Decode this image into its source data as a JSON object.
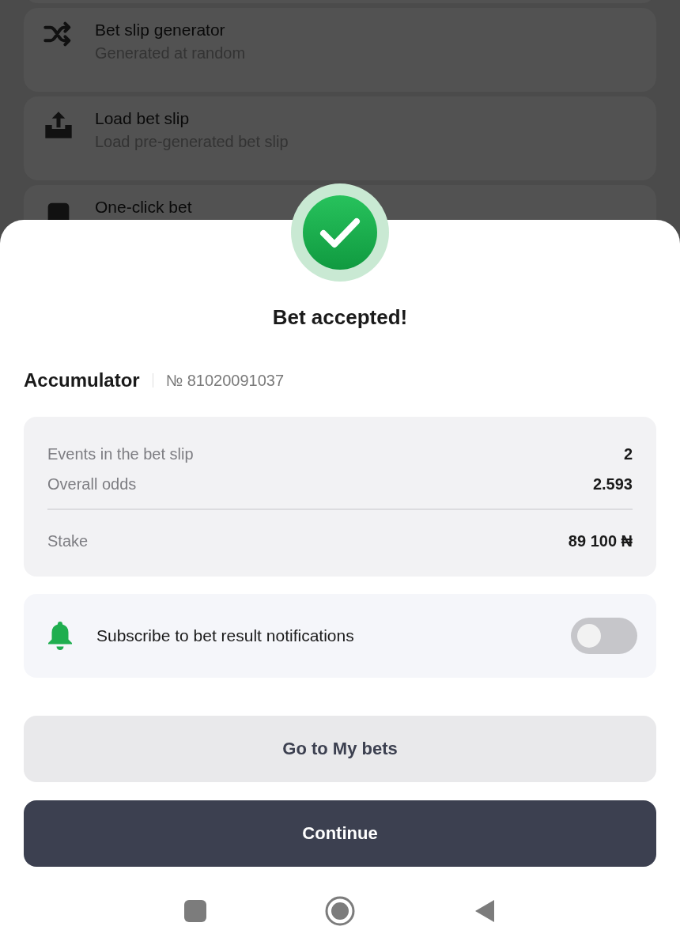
{
  "background_menu": [
    {
      "kind": "shuffle",
      "title": "Bet slip generator",
      "subtitle": "Generated at random"
    },
    {
      "kind": "upload",
      "title": "Load bet slip",
      "subtitle": "Load pre-generated bet slip"
    },
    {
      "kind": "partial",
      "title": "One-click bet"
    }
  ],
  "sheet": {
    "title": "Bet accepted!",
    "bet_type": "Accumulator",
    "bet_number": "№ 81020091037",
    "summary": [
      {
        "label": "Events in the bet slip",
        "value": "2"
      },
      {
        "label": "Overall odds",
        "value": "2.593"
      },
      {
        "label": "Stake",
        "value": "89 100 ₦",
        "divider_before": true
      }
    ],
    "notification": {
      "label": "Subscribe to bet result notifications",
      "on": false
    },
    "buttons": [
      {
        "kind": "secondary",
        "label": "Go to My bets"
      },
      {
        "kind": "primary",
        "label": "Continue"
      }
    ]
  }
}
